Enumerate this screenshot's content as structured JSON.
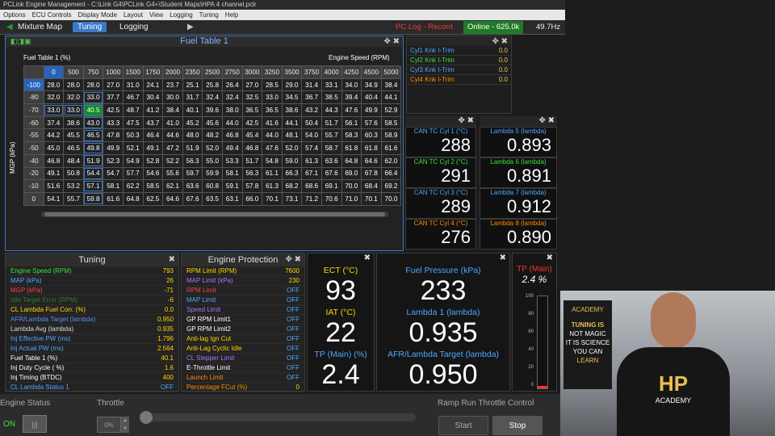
{
  "window": {
    "title": "PCLink Engine Management - C:\\Link G4\\PCLink G4+\\Student Maps\\HPA 4 channel.pclr"
  },
  "menu": [
    "Options",
    "ECU Controls",
    "Display Mode",
    "Layout",
    "View",
    "Logging",
    "Tuning",
    "Help"
  ],
  "toolbar": {
    "mixture": "Mixture Map",
    "tuning": "Tuning",
    "logging": "Logging",
    "pclog": "PC Log - Record",
    "online": "Online - 625.0k",
    "hz": "49.7Hz"
  },
  "fuel": {
    "title": "Fuel Table 1",
    "subtitle": "Fuel Table 1 (%)",
    "xaxis": "Engine Speed (RPM)",
    "yaxis": "MGP (kPa)",
    "rpm": [
      "0",
      "500",
      "750",
      "1000",
      "1500",
      "1750",
      "2000",
      "2350",
      "2500",
      "2750",
      "3000",
      "3250",
      "3500",
      "3750",
      "4000",
      "4250",
      "4500",
      "5000"
    ],
    "mgp": [
      "-100",
      "-80",
      "-70",
      "-60",
      "-55",
      "-50",
      "-40",
      "-20",
      "-10",
      "0"
    ],
    "rows": [
      [
        "28.0",
        "28.0",
        "28.0",
        "27.0",
        "31.0",
        "24.1",
        "23.7",
        "25.1",
        "25.8",
        "26.4",
        "27.0",
        "28.5",
        "29.0",
        "31.4",
        "33.1",
        "34.0",
        "34.9",
        "38.4"
      ],
      [
        "32.0",
        "32.0",
        "33.0",
        "37.7",
        "46.7",
        "30.4",
        "30.0",
        "31.7",
        "32.4",
        "32.4",
        "32.5",
        "33.0",
        "34.5",
        "36.7",
        "38.5",
        "39.4",
        "40.4",
        "44.1"
      ],
      [
        "33.0",
        "33.0",
        "40.5",
        "42.5",
        "48.7",
        "41.2",
        "38.4",
        "40.1",
        "39.6",
        "38.0",
        "36.5",
        "36.5",
        "38.6",
        "43.2",
        "44.3",
        "47.6",
        "49.9",
        "52.9"
      ],
      [
        "37.4",
        "38.6",
        "43.0",
        "43.3",
        "47.5",
        "43.7",
        "41.0",
        "45.2",
        "45.6",
        "44.0",
        "42.5",
        "41.6",
        "44.1",
        "50.4",
        "51.7",
        "56.1",
        "57.6",
        "58.5"
      ],
      [
        "44.2",
        "45.5",
        "46.5",
        "47.8",
        "50.3",
        "46.4",
        "44.6",
        "48.0",
        "48.2",
        "46.8",
        "45.4",
        "44.0",
        "48.1",
        "54.0",
        "55.7",
        "58.3",
        "60.3",
        "58.9"
      ],
      [
        "45.0",
        "46.5",
        "49.8",
        "49.9",
        "52.1",
        "49.1",
        "47.2",
        "51.9",
        "52.0",
        "49.4",
        "46.8",
        "47.6",
        "52.0",
        "57.4",
        "58.7",
        "61.8",
        "61.8",
        "61.6"
      ],
      [
        "46.8",
        "48.4",
        "51.9",
        "52.3",
        "54.9",
        "52.8",
        "52.2",
        "56.3",
        "55.0",
        "53.3",
        "51.7",
        "54.8",
        "59.0",
        "61.3",
        "63.6",
        "64.8",
        "64.6",
        "62.0"
      ],
      [
        "49.1",
        "50.8",
        "54.4",
        "54.7",
        "57.7",
        "54.6",
        "55.6",
        "59.7",
        "59.9",
        "58.1",
        "56.3",
        "61.1",
        "66.3",
        "67.1",
        "67.6",
        "69.0",
        "67.8",
        "66.4"
      ],
      [
        "51.6",
        "53.2",
        "57.1",
        "58.1",
        "62.2",
        "58.5",
        "62.1",
        "63.6",
        "60.8",
        "59.1",
        "57.8",
        "61.3",
        "68.2",
        "68.6",
        "69.1",
        "70.0",
        "68.4",
        "69.2"
      ],
      [
        "54.1",
        "55.7",
        "59.8",
        "61.6",
        "64.8",
        "62.5",
        "64.6",
        "67.6",
        "63.5",
        "63.1",
        "66.0",
        "70.1",
        "73.1",
        "71.2",
        "70.6",
        "71.0",
        "70.1",
        "70.0"
      ]
    ]
  },
  "knock": [
    {
      "l": "Cyl1 Knk I-Trim",
      "v": "0.0"
    },
    {
      "l": "Cyl2 Knk I-Trim",
      "v": "0.0"
    },
    {
      "l": "Cyl3 Knk I-Trim",
      "v": "0.0"
    },
    {
      "l": "Cyl4 Knk I-Trim",
      "v": "0.0"
    }
  ],
  "cantc": [
    {
      "l": "CAN TC Cyl 1 (°C)",
      "v": "288"
    },
    {
      "l": "CAN TC Cyl 2 (°C)",
      "v": "291"
    },
    {
      "l": "CAN TC Cyl 3 (°C)",
      "v": "289"
    },
    {
      "l": "CAN TC Cyl 4 (°C)",
      "v": "276"
    }
  ],
  "lambda": [
    {
      "l": "Lambda 5 (lambda)",
      "v": "0.893"
    },
    {
      "l": "Lambda 6 (lambda)",
      "v": "0.891"
    },
    {
      "l": "Lambda 7 (lambda)",
      "v": "0.912"
    },
    {
      "l": "Lambda 8 (lambda)",
      "v": "0.890"
    }
  ],
  "tuning": {
    "title": "Tuning",
    "rows": [
      {
        "l": "Engine Speed (RPM)",
        "v": "793",
        "c": "#3ae03a"
      },
      {
        "l": "MAP (kPa)",
        "v": "26",
        "c": "#4aa8ff"
      },
      {
        "l": "MGP (kPa)",
        "v": "-71",
        "c": "#ff4040"
      },
      {
        "l": "Idle Target Error (RPM)",
        "v": "-6",
        "c": "#2d7a2d"
      },
      {
        "l": "CL Lambda  Fuel  Corr. (%)",
        "v": "0.0",
        "c": "#ffd400"
      },
      {
        "l": "AFR/Lambda Target (lambda)",
        "v": "0.950",
        "c": "#5a8cff"
      },
      {
        "l": "Lambda Avg (lambda)",
        "v": "0.935",
        "c": "#dddddd"
      },
      {
        "l": "Inj Effective PW (ms)",
        "v": "1.796",
        "c": "#4aa8ff"
      },
      {
        "l": "Inj Actual PW (ms)",
        "v": "2.564",
        "c": "#4aa8ff"
      },
      {
        "l": "Fuel Table 1 (%)",
        "v": "40.1",
        "c": "#ffffff"
      },
      {
        "l": "Inj Duty Cycle ( %)",
        "v": "1.6",
        "c": "#ffffff"
      },
      {
        "l": "Inj Timing (BTDC)",
        "v": "400",
        "c": "#ffffff"
      },
      {
        "l": "CL Lambda Status 1",
        "v": "OFF",
        "c": "#4aa8ff"
      }
    ]
  },
  "protect": {
    "title": "Engine Protection",
    "rows": [
      {
        "l": "RPM Limit (RPM)",
        "v": "7600",
        "c": "#ffd400"
      },
      {
        "l": "MAP Limit (kPa)",
        "v": "230",
        "c": "#b070ff"
      },
      {
        "l": "RPM Limit",
        "v": "OFF",
        "c": "#ff4040"
      },
      {
        "l": "MAP Limit",
        "v": "OFF",
        "c": "#4aa8ff"
      },
      {
        "l": "Speed Limit",
        "v": "OFF",
        "c": "#b070ff"
      },
      {
        "l": "GP RPM Limit1",
        "v": "OFF",
        "c": "#ffffff"
      },
      {
        "l": "GP RPM Limit2",
        "v": "OFF",
        "c": "#ffffff"
      },
      {
        "l": "Anti-lag Ign Cut",
        "v": "OFF",
        "c": "#ffd400"
      },
      {
        "l": "Anti-Lag Cyclic Idle",
        "v": "OFF",
        "c": "#ffd400"
      },
      {
        "l": "CL Stepper Limit",
        "v": "OFF",
        "c": "#b070ff"
      },
      {
        "l": "E-Throttle Limit",
        "v": "OFF",
        "c": "#ffffff"
      },
      {
        "l": "Launch Limit",
        "v": "OFF",
        "c": "#ff8c00"
      },
      {
        "l": "Percentage FCut (%)",
        "v": "0",
        "c": "#ff8c00"
      }
    ]
  },
  "ect": {
    "l": "ECT (°C)",
    "v": "93"
  },
  "iat": {
    "l": "IAT (°C)",
    "v": "22"
  },
  "tp": {
    "l": "TP (Main) (%)",
    "v": "2.4"
  },
  "fp": {
    "l": "Fuel Pressure (kPa)",
    "v": "233"
  },
  "lam1": {
    "l": "Lambda 1 (lambda)",
    "v": "0.935"
  },
  "afr": {
    "l": "AFR/Lambda Target (lambda)",
    "v": "0.950"
  },
  "tpbar": {
    "l": "TP (Main)",
    "v": "2.4 %",
    "ticks": [
      "100",
      "80",
      "60",
      "40",
      "20",
      "0"
    ],
    "level": 0.024
  },
  "bottom": {
    "engine_status": "Engine Status",
    "on": "ON",
    "throttle": "Throttle",
    "pct": "0%",
    "ramp": "Ramp Run Throttle Control",
    "start": "Start",
    "stop": "Stop"
  },
  "video": {
    "sign1": "ACADEMY",
    "sign2": "TUNING IS",
    "sign3": "NOT MAGIC",
    "sign4": "IT IS SCIENCE",
    "sign5": "YOU CAN",
    "sign6": "LEARN",
    "shirt1": "HP",
    "shirt2": "ACADEMY"
  }
}
